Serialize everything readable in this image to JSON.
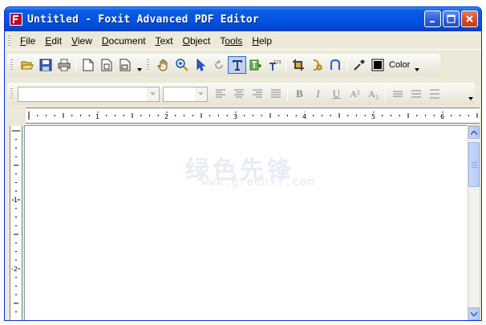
{
  "window": {
    "title": "Untitled - Foxit Advanced PDF Editor"
  },
  "menu": [
    {
      "label": "File",
      "key": "F",
      "rest": "ile"
    },
    {
      "label": "Edit",
      "key": "E",
      "rest": "dit"
    },
    {
      "label": "View",
      "key": "V",
      "rest": "iew"
    },
    {
      "label": "Document",
      "key": "D",
      "rest": "ocument"
    },
    {
      "label": "Text",
      "key": "T",
      "rest": "ext"
    },
    {
      "label": "Object",
      "key": "O",
      "rest": "bject"
    },
    {
      "label": "Tools",
      "key": "T",
      "rest": "ools"
    },
    {
      "label": "Help",
      "key": "H",
      "rest": "elp"
    }
  ],
  "toolbar": {
    "color_label": "Color"
  },
  "format": {
    "font_value": "",
    "size_value": "",
    "bold": "B",
    "italic": "I",
    "underline": "U",
    "superscript": "A²",
    "subscript": "A₂"
  },
  "ruler": {
    "h_labels": [
      "1",
      "2",
      "3",
      "4",
      "5",
      "6"
    ],
    "v_labels": [
      "1",
      "2"
    ]
  },
  "watermark": {
    "cn": "绿色先锋",
    "en": "www.greenxf.com"
  },
  "colors": {
    "titlebar": "#0454e6",
    "menubar": "#ece9d8",
    "app_icon": "#b8082e"
  }
}
